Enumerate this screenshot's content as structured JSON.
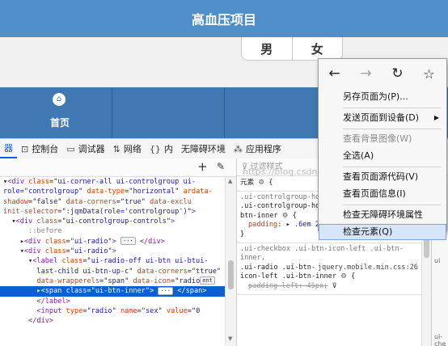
{
  "app": {
    "title": "高血压项目",
    "gender_options": [
      "男",
      "女"
    ],
    "nav": [
      {
        "icon": "home-icon",
        "label": "首页"
      },
      {
        "label": ""
      },
      {
        "label": ""
      },
      {
        "label": ""
      }
    ]
  },
  "devtools": {
    "tabs": [
      {
        "label": "器",
        "icon": ""
      },
      {
        "label": "控制台",
        "icon": "console-icon"
      },
      {
        "label": "调试器",
        "icon": "debugger-icon"
      },
      {
        "label": "网络",
        "icon": "network-icon"
      },
      {
        "label": "内",
        "icon": "style-editor-icon"
      },
      {
        "label": "无障碍环境",
        "icon": ""
      },
      {
        "label": "应用程序",
        "icon": "application-icon"
      }
    ],
    "inspector": {
      "add_node": "+",
      "markup": [
        {
          "html": "▾<span class=\"tg\">&lt;div</span> <span class=\"an\">class</span>=\"<span class=\"av\">ui-corner-all ui-controlgroup ui-</span>"
        },
        {
          "html": "<span class=\"av\">role</span>=\"<span class=\"av\">controlgroup</span>\" <span class=\"an\">data-type</span>=\"<span class=\"av\">horizontal</span>\" <span class=\"an\">ardata-</span>"
        },
        {
          "html": "<span class=\"an\">shadow</span>=\"<span class=\"av\">false</span>\" <span class=\"an\">data-corners</span>=\"<span class=\"av\">true</span>\" <span class=\"an\">data-exclu</span>"
        },
        {
          "html": "<span class=\"an\">init-selector</span>=\"<span class=\"av\">:jqmData(role='controlgroup')</span>\"<span class=\"tg\">&gt;</span>"
        },
        {
          "html": "  ▾<span class=\"tg\">&lt;div</span> <span class=\"an\">class</span>=\"<span class=\"av\">ui-controlgroup-controls</span>\"<span class=\"tg\">&gt;</span>"
        },
        {
          "html": "      <span class=\"pe\">::before</span>"
        },
        {
          "html": "    ▸<span class=\"tg\">&lt;div</span> <span class=\"an\">class</span>=\"<span class=\"av\">ui-radio</span>\"<span class=\"tg\">&gt;</span> <span class=\"badge\">···</span> <span class=\"tg\">&lt;/div&gt;</span>"
        },
        {
          "html": "    ▾<span class=\"tg\">&lt;div</span> <span class=\"an\">class</span>=\"<span class=\"av\">ui-radio</span>\"<span class=\"tg\">&gt;</span>"
        },
        {
          "html": "      ▾<span class=\"tg\">&lt;label</span> <span class=\"an\">class</span>=\"<span class=\"av\">ui-radio-off ui-btn ui-btui-</span>"
        },
        {
          "html": "        <span class=\"av\">last-child ui-btn-up-c</span>\" <span class=\"an\">data-corners</span>=\"<span class=\"av\">ttrue</span>\""
        },
        {
          "html": "        <span class=\"an\">data-wrapperels</span>=\"<span class=\"av\">span</span>\" <span class=\"an\">data-icon</span>=\"<span class=\"av\">radio</span><span class=\"badge\">ent</span>"
        },
        {
          "html": "        ▸&lt;span class=\"ui-btn-inner\"&gt; <span class=\"badge\">···</span> &lt;/span&gt;",
          "selected": true
        },
        {
          "html": "        <span class=\"tg\">&lt;/label&gt;</span>"
        },
        {
          "html": "        <span class=\"tg\">&lt;input</span> <span class=\"an\">type</span>=\"<span class=\"av\">radio</span>\" <span class=\"an\">name</span>=\"<span class=\"av\">sex</span>\" <span class=\"an\">value</span>=\"<span class=\"av\">0</span>"
        },
        {
          "html": "      <span class=\"tg\">&lt;/div&gt;</span>"
        }
      ]
    },
    "rules": {
      "filter_placeholder": "过滤样式",
      "element_rule": "元素",
      "blocks": [
        {
          "selector_gray": ".ui-controlgroup-horizontal .ui-checkbox",
          "source": "",
          "selector": ".ui-controlgroup-horizontal .ui-radio .ui-btn-inner",
          "prop": "padding",
          "value": ".6em 20px",
          "struck": false
        },
        {
          "selector_gray": ".ui-checkbox .ui-btn-icon-left .ui-btn-inner,",
          "source": "jquery.mobile.min.css:26",
          "selector": ".ui-radio .ui-btn-icon-left .ui-btn-inner",
          "prop": "padding-left",
          "value": "45px",
          "struck": true
        }
      ],
      "side_fragment_1": "ui",
      "side_fragment_2": "ui-che",
      "watermark": "https://blog.csdn.net/@51CTO博客"
    }
  },
  "context_menu": {
    "nav": [
      {
        "icon": "back-arrow-icon",
        "glyph": "←",
        "enabled": true
      },
      {
        "icon": "forward-arrow-icon",
        "glyph": "→",
        "enabled": false
      },
      {
        "icon": "reload-icon",
        "glyph": "↻",
        "enabled": true
      },
      {
        "icon": "bookmark-star-icon",
        "glyph": "☆",
        "enabled": true
      }
    ],
    "items": [
      {
        "label": "另存页面为(P)...",
        "enabled": true
      },
      {
        "separator": true
      },
      {
        "label": "发送页面到设备(D)",
        "enabled": true,
        "submenu": true
      },
      {
        "separator": true
      },
      {
        "label": "查看背景图像(W)",
        "enabled": false
      },
      {
        "label": "全选(A)",
        "enabled": true
      },
      {
        "separator": true
      },
      {
        "label": "查看页面源代码(V)",
        "enabled": true
      },
      {
        "label": "查看页面信息(I)",
        "enabled": true
      },
      {
        "separator": true
      },
      {
        "label": "检查无障碍环境属性",
        "enabled": true
      },
      {
        "label": "检查元素(Q)",
        "enabled": true,
        "highlighted": true
      }
    ]
  }
}
